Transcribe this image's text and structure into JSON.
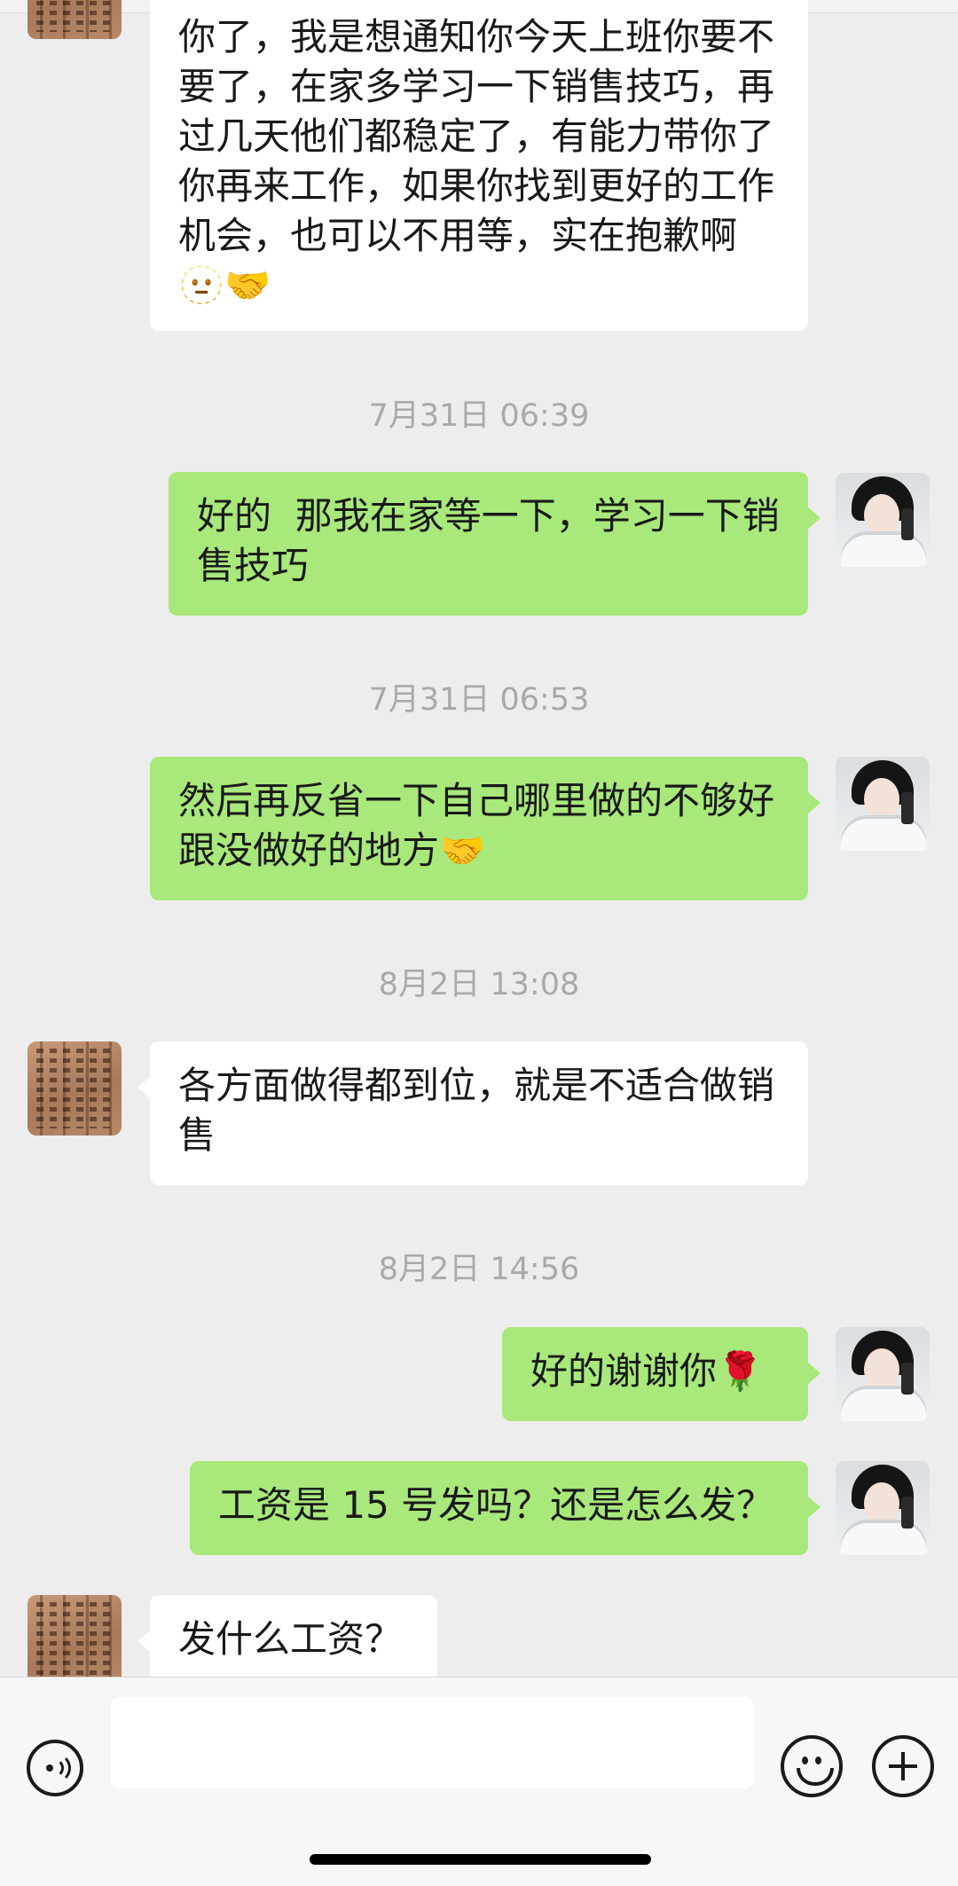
{
  "messages": [
    {
      "text": "你了，我是想通知你今天上班你要不要了，在家多学习一下销售技巧，再过几天他们都稳定了，有能力带你了你再来工作，如果你找到更好的工作机会，也可以不用等，实在抱歉啊🫥🤝"
    },
    {
      "text": "好的  那我在家等一下，学习一下销售技巧"
    },
    {
      "text": "然后再反省一下自己哪里做的不够好跟没做好的地方🤝"
    },
    {
      "text": "各方面做得都到位，就是不适合做销售"
    },
    {
      "text": "好的谢谢你🌹"
    },
    {
      "text": "工资是 15 号发吗？还是怎么发？"
    },
    {
      "text": "发什么工资？"
    }
  ],
  "timestamps": [
    "7月31日 06:39",
    "7月31日 06:53",
    "8月2日 13:08",
    "8月2日 14:56"
  ],
  "input": {
    "value": ""
  },
  "icons": {
    "voice": "voice-icon",
    "emoji": "emoji-icon",
    "plus": "plus-icon"
  }
}
